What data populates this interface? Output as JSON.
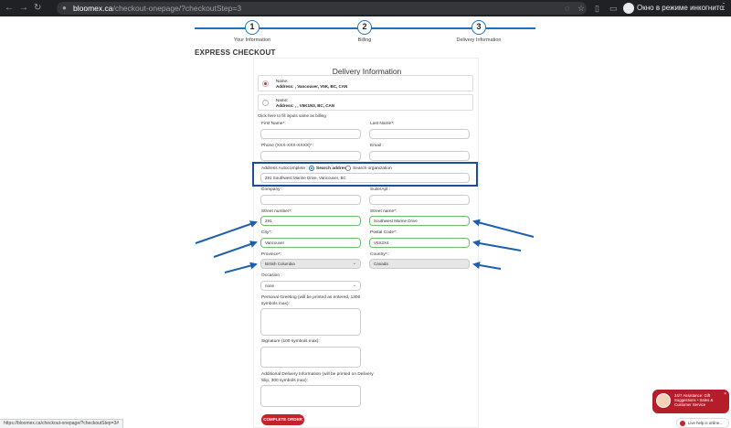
{
  "browser": {
    "url_host": "bloomex.ca",
    "url_path": "/checkout-onepage/?checkoutStep=3",
    "profile_label": "Окно в режиме инкогнито"
  },
  "steps": [
    {
      "number": "1",
      "label": "Your Information"
    },
    {
      "number": "2",
      "label": "Billing"
    },
    {
      "number": "3",
      "label": "Delivery Information"
    }
  ],
  "page_heading": "EXPRESS CHECKOUT",
  "form": {
    "title": "Delivery Information",
    "saved_addresses": [
      {
        "name": "Name:",
        "address": "Address: , Vancouver, V5K, BC, CAN",
        "selected": true
      },
      {
        "name": "Name:",
        "address": "Address: , , V5K1N3, BC, CAN",
        "selected": false
      }
    ],
    "billing_hint": "Click here to fill inputs same as billing",
    "first_name_label": "First Name*:",
    "last_name_label": "Last Name*:",
    "phone_label": "Phone (XXX-XXX-XXXX)*:",
    "email_label": "Email :",
    "autocomplete_label": "Address Autocomplete :",
    "search_address_label": "Search address",
    "search_org_label": "Search organization",
    "autocomplete_value": "291 Southwest Marine Drive, Vancouver, BC",
    "company_label": "Company :",
    "suite_label": "Suite/Apt :",
    "street_number_label": "Street number*:",
    "street_number_value": "291",
    "street_name_label": "Street name*:",
    "street_name_value": "Southwest Marine Drive",
    "city_label": "City*:",
    "city_value": "Vancouver",
    "postal_label": "Postal Code*:",
    "postal_value": "V5X2X4",
    "province_label": "Province*:",
    "province_value": "British Columbia",
    "country_label": "Country*:",
    "country_value": "Canada",
    "occasion_label": "Occasion :",
    "occasion_value": "none",
    "greeting_label": "Personal Greeting (will be printed as entered, 1300 symbols max):",
    "signature_label": "Signature (100 symbols max):",
    "additional_label": "Additional Delivery Information (will be printed on Delivery Slip, 300 symbols max):",
    "complete_button": "COMPLETE ORDER"
  },
  "status_bar": "https://bloomex.ca/checkout-onepage/?checkoutStep=3#",
  "chat": {
    "text": "24/7 Assistance: Gift Suggestions • Sales & Customer Service",
    "online": "Live help is online..."
  },
  "colors": {
    "accent": "#1e73be",
    "annotation": "#1a4f9c",
    "brand_red": "#c6222a"
  }
}
